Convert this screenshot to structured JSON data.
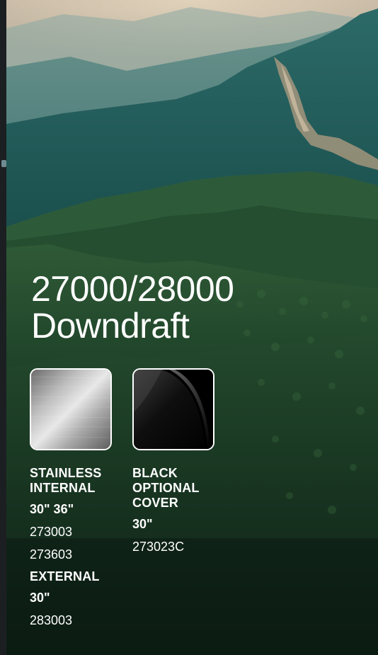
{
  "product": {
    "title_line1": "27000/28000",
    "title_line2": "Downdraft"
  },
  "finishes": {
    "stainless": {
      "swatch_icon": "brushed-stainless-swatch",
      "heading_line1": "STAINLESS",
      "heading_line2": "INTERNAL",
      "internal_sizes": "30\" 36\"",
      "internal_models": [
        "273003",
        "273603"
      ],
      "external_heading": "EXTERNAL",
      "external_size": "30\"",
      "external_model": "283003"
    },
    "black": {
      "swatch_icon": "glossy-black-swatch",
      "heading_line1": "BLACK",
      "heading_line2": "OPTIONAL",
      "heading_line3": "COVER",
      "size": "30\"",
      "model": "273023C"
    }
  },
  "colors": {
    "text": "#ffffff",
    "swatch_border": "#ffffff",
    "forest_dark": "#10251a",
    "ridge_teal": "#1f5e5c",
    "sky": "#c9b9a4"
  }
}
